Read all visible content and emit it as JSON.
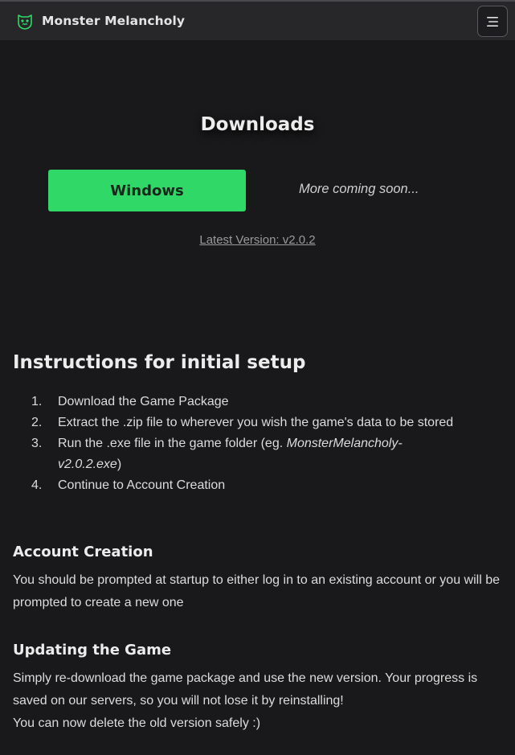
{
  "navbar": {
    "brand_icon": "monster-face-icon",
    "brand_name": "Monster Melancholy",
    "menu_icon": "hamburger-menu-icon"
  },
  "downloads": {
    "title": "Downloads",
    "windows_button": "Windows",
    "coming_soon": "More coming soon...",
    "latest_version": "Latest Version: v2.0.2"
  },
  "instructions": {
    "title": "Instructions for initial setup",
    "steps": [
      {
        "num": "1.",
        "text": "Download the Game Package"
      },
      {
        "num": "2.",
        "text": "Extract the .zip file to wherever you wish the game's data to be stored"
      },
      {
        "num": "3.",
        "text": "Run the .exe file in the game folder (eg. ",
        "em": "MonsterMelancholy-v2.0.2.exe",
        "after": ")"
      },
      {
        "num": "4.",
        "text": "Continue to Account Creation"
      }
    ]
  },
  "account": {
    "title": "Account Creation",
    "body": "You should be prompted at startup to either log in to an existing account or you will be prompted to create a new one"
  },
  "updating": {
    "title": "Updating the Game",
    "body_line1": "Simply re-download the game package and use the new version. Your progress is saved on our servers, so you will not lose it by reinstalling!",
    "body_line2": "You can now delete the old version safely :)"
  },
  "colors": {
    "background": "#19191b",
    "navbar": "#27272a",
    "accent_green": "#2fd867"
  }
}
